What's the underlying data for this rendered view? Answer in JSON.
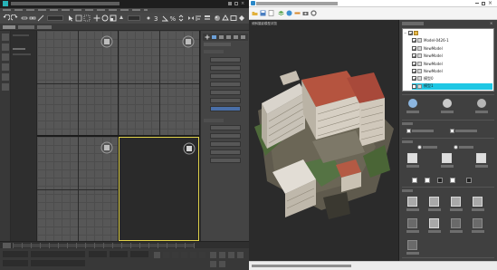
{
  "left_app": {
    "viewports": {
      "perspective_label": ""
    },
    "command_panel": {
      "buttons": [
        {
          "name": "button-1",
          "active": false
        },
        {
          "name": "button-2",
          "active": false
        },
        {
          "name": "button-3",
          "active": false
        },
        {
          "name": "button-4",
          "active": false
        },
        {
          "name": "button-5",
          "active": false
        },
        {
          "name": "button-6",
          "active": false
        },
        {
          "name": "button-7",
          "active": true
        }
      ]
    }
  },
  "right_app": {
    "viewport_label": "倾斜摄影模型浏览",
    "tree": {
      "items": [
        {
          "label": "",
          "checked": true,
          "icon": "folder-icon",
          "indent": 0,
          "expander": "−"
        },
        {
          "label": "Model-0426-1",
          "checked": true,
          "icon": "model-icon",
          "indent": 1
        },
        {
          "label": "NewModel",
          "checked": true,
          "icon": "model-icon",
          "indent": 1
        },
        {
          "label": "NewModel",
          "checked": true,
          "icon": "model-icon",
          "indent": 1
        },
        {
          "label": "NewModel",
          "checked": true,
          "icon": "model-icon",
          "indent": 1
        },
        {
          "label": "NewModel",
          "checked": true,
          "icon": "model-icon",
          "indent": 1
        },
        {
          "label": "模型0",
          "checked": true,
          "icon": "model-icon",
          "indent": 1
        },
        {
          "label": "模型1",
          "checked": false,
          "icon": "model-icon",
          "indent": 1,
          "selected": true
        }
      ]
    },
    "colors": {
      "selection": "#1fc7e4",
      "viewport_frame_active": "#e1d24a",
      "roof_red": "#b5543f",
      "facade_white": "#d9d4cc",
      "foliage": "#4e6a3a"
    }
  }
}
